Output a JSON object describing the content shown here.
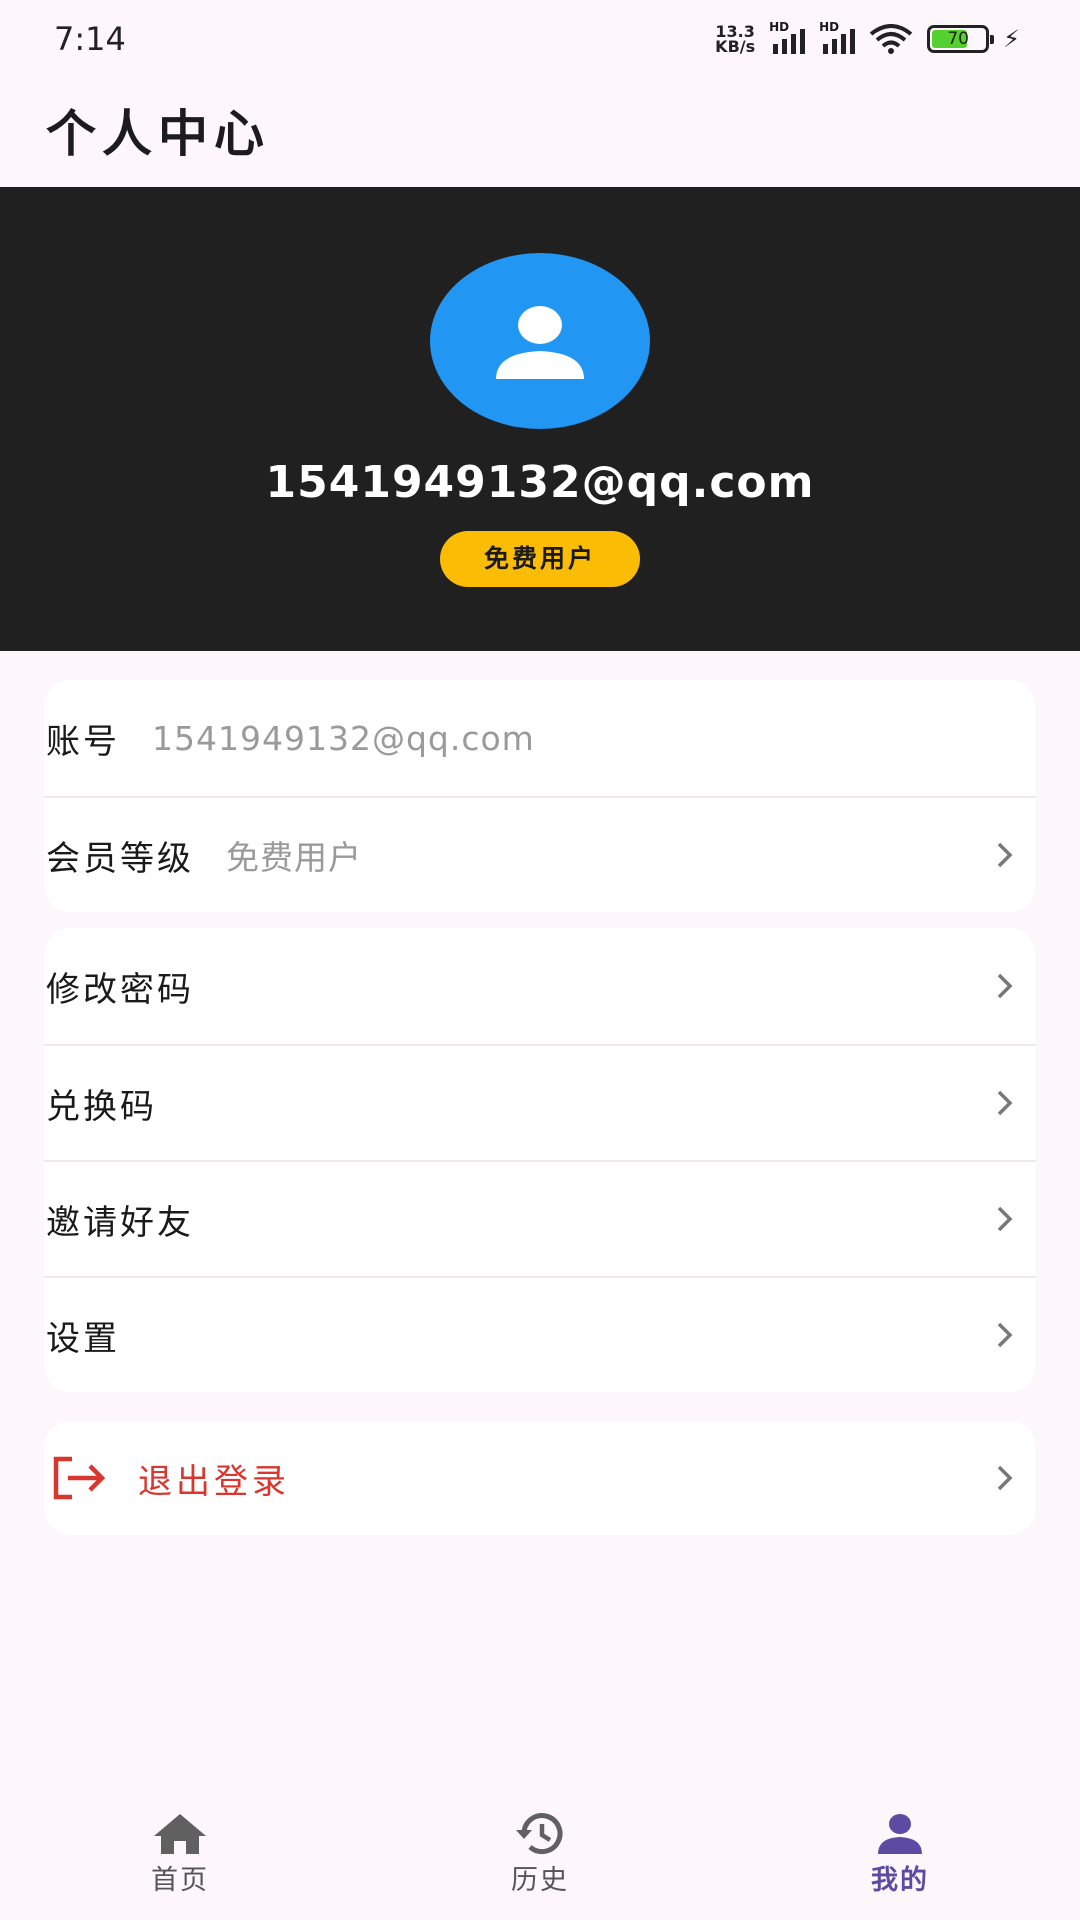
{
  "status_bar": {
    "time": "7:14",
    "net_speed_value": "13.3",
    "net_speed_unit": "KB/s",
    "hd_label": "HD",
    "battery_level": "70",
    "battery_fraction": 0.7,
    "battery_color": "#55d12f"
  },
  "app_bar": {
    "title": "个人中心"
  },
  "profile": {
    "avatar_icon": "person-icon",
    "email": "1541949132@qq.com",
    "membership_badge": "免费用户",
    "avatar_color": "#2196f3",
    "badge_color": "#fbbc05",
    "header_bg": "#202020"
  },
  "account_card": {
    "rows": [
      {
        "label": "账号",
        "value": "1541949132@qq.com",
        "has_chevron": false
      },
      {
        "label": "会员等级",
        "value": "免费用户",
        "has_chevron": true
      }
    ]
  },
  "menu_card": {
    "rows": [
      {
        "label": "修改密码"
      },
      {
        "label": "兑换码"
      },
      {
        "label": "邀请好友"
      },
      {
        "label": "设置"
      }
    ]
  },
  "logout": {
    "label": "退出登录",
    "icon": "logout-icon",
    "color": "#d9362d"
  },
  "bottom_nav": {
    "items": [
      {
        "label": "首页",
        "icon": "home-icon",
        "active": false
      },
      {
        "label": "历史",
        "icon": "history-icon",
        "active": false
      },
      {
        "label": "我的",
        "icon": "person-icon",
        "active": true
      }
    ],
    "active_color": "#5b4ba3"
  }
}
